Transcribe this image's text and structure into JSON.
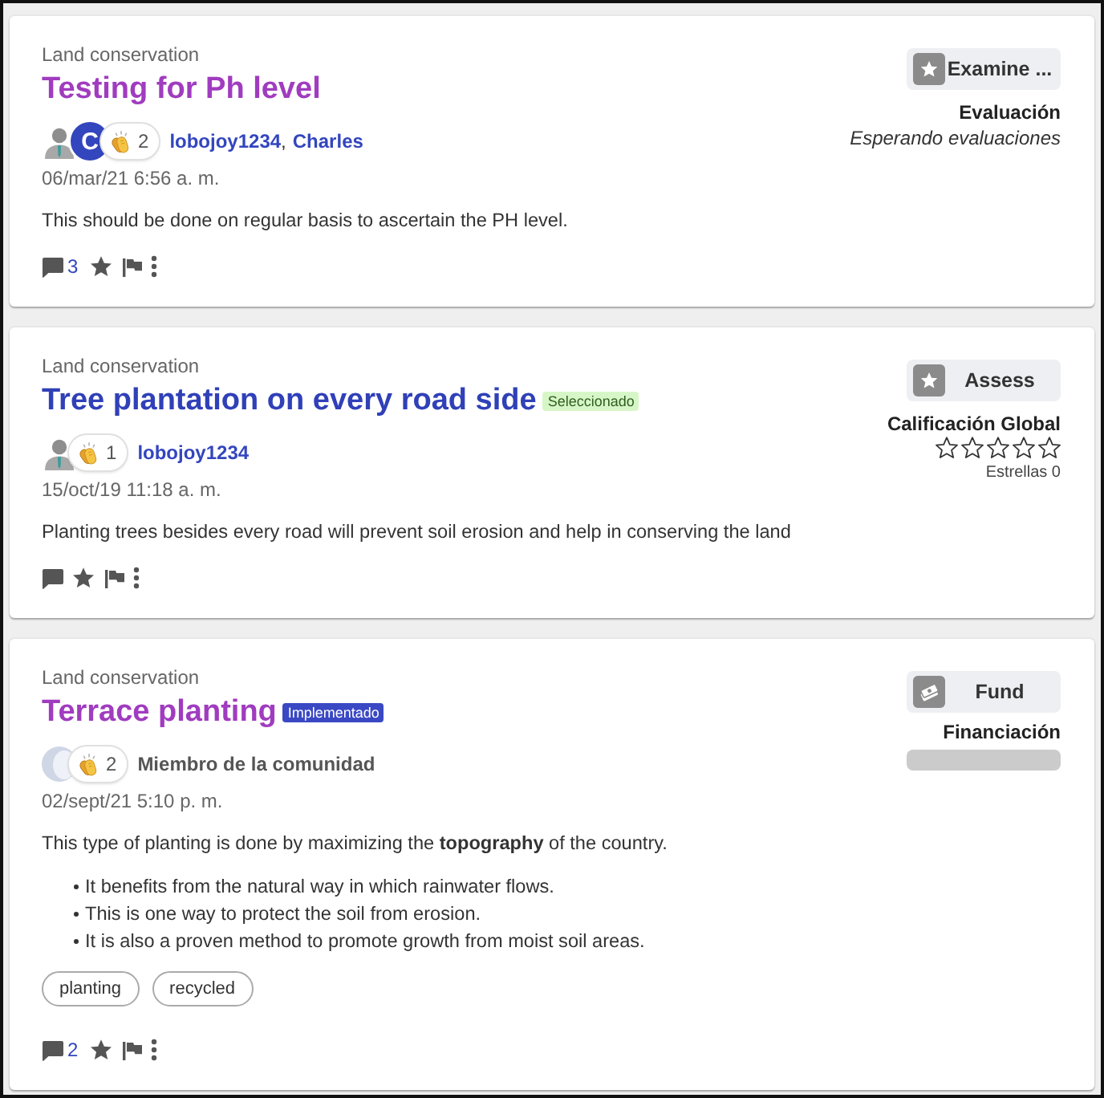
{
  "posts": [
    {
      "category": "Land conservation",
      "title": "Testing for Ph level",
      "visited": true,
      "avatars": [
        {
          "kind": "photo"
        },
        {
          "kind": "initial",
          "initial": "C"
        }
      ],
      "reactions": "2",
      "authors": [
        {
          "text": "lobojoy1234",
          "kind": "link"
        },
        {
          "text": ",",
          "kind": "separator"
        },
        {
          "text": "Charles",
          "kind": "link"
        }
      ],
      "date": "06/mar/21 6:56 a. m.",
      "body": [
        {
          "kind": "paragraph",
          "text": "This should be done on regular basis to ascertain the PH level."
        }
      ],
      "comments": "3",
      "action_button": {
        "label": "Examine ...",
        "kind": "review"
      },
      "summary": {
        "kind": "status",
        "heading": "Evaluación",
        "text": "Esperando evaluaciones"
      }
    },
    {
      "category": "Land conservation",
      "title": "Tree plantation on every road side",
      "visited": false,
      "status_badge": {
        "text": "Seleccionado",
        "kind": "selected"
      },
      "avatars": [
        {
          "kind": "photo"
        }
      ],
      "reactions": "1",
      "authors": [
        {
          "text": "lobojoy1234",
          "kind": "link"
        }
      ],
      "date": "15/oct/19 11:18 a. m.",
      "body": [
        {
          "kind": "paragraph",
          "text": "Planting trees besides every road will prevent soil erosion and help in conserving the land"
        }
      ],
      "action_button": {
        "label": "Assess",
        "kind": "review"
      },
      "summary": {
        "kind": "rating",
        "heading": "Calificación Global",
        "stars": 0,
        "caption": "Estrellas 0"
      }
    },
    {
      "category": "Land conservation",
      "title": "Terrace planting",
      "visited": true,
      "status_badge": {
        "text": "Implementado",
        "kind": "implemented"
      },
      "avatars": [
        {
          "kind": "placeholder"
        }
      ],
      "reactions": "2",
      "authors": [
        {
          "text": "Miembro de la comunidad",
          "kind": "plain"
        }
      ],
      "date": "02/sept/21 5:10 p. m.",
      "body": [
        {
          "kind": "paragraph",
          "text": "This type of planting is done by maximizing the **topography** of the country."
        },
        {
          "kind": "bullets",
          "items": [
            "It benefits from the natural way in which rainwater flows.",
            "This is one way to protect the soil from erosion.",
            "It is also a proven method to promote growth from moist soil areas."
          ]
        }
      ],
      "tags": [
        "planting",
        "recycled"
      ],
      "comments": "2",
      "action_button": {
        "label": "Fund",
        "kind": "funding"
      },
      "summary": {
        "kind": "funding",
        "heading": "Financiación",
        "level": 0
      }
    }
  ]
}
